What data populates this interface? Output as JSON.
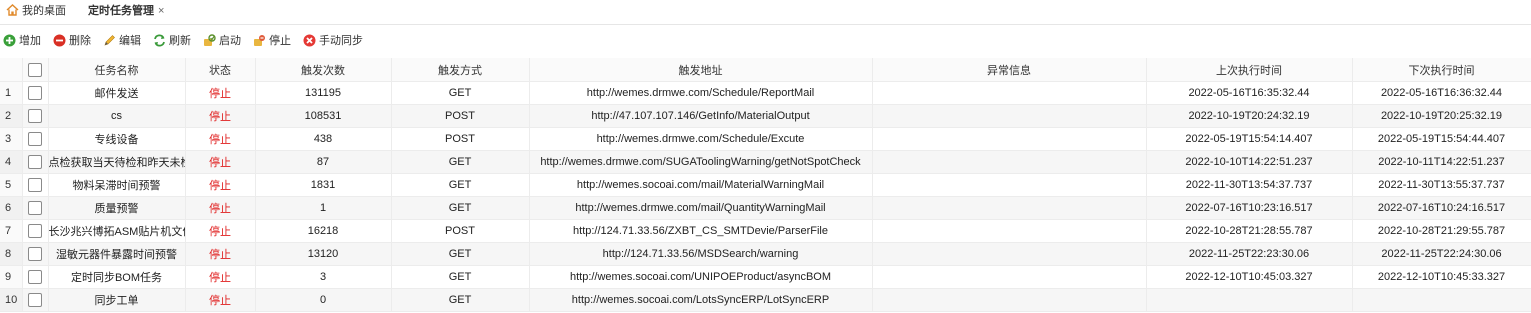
{
  "tabs": {
    "home_label": "我的桌面",
    "active_label": "定时任务管理",
    "close_glyph": "×"
  },
  "toolbar": {
    "add": "增加",
    "delete": "删除",
    "edit": "编辑",
    "refresh": "刷新",
    "start": "启动",
    "stop": "停止",
    "manual_sync": "手动同步"
  },
  "table": {
    "headers": [
      "任务名称",
      "状态",
      "触发次数",
      "触发方式",
      "触发地址",
      "异常信息",
      "上次执行时间",
      "下次执行时间"
    ],
    "rows": [
      {
        "rn": "1",
        "name": "邮件发送",
        "state": "停止",
        "count": "131195",
        "method": "GET",
        "url": "http://wemes.drmwe.com/Schedule/ReportMail",
        "error": "",
        "last": "2022-05-16T16:35:32.44",
        "next": "2022-05-16T16:36:32.44"
      },
      {
        "rn": "2",
        "name": "cs",
        "state": "停止",
        "count": "108531",
        "method": "POST",
        "url": "http://47.107.107.146/GetInfo/MaterialOutput",
        "error": "",
        "last": "2022-10-19T20:24:32.19",
        "next": "2022-10-19T20:25:32.19"
      },
      {
        "rn": "3",
        "name": "专线设备",
        "state": "停止",
        "count": "438",
        "method": "POST",
        "url": "http://wemes.drmwe.com/Schedule/Excute",
        "error": "",
        "last": "2022-05-19T15:54:14.407",
        "next": "2022-05-19T15:54:44.407"
      },
      {
        "rn": "4",
        "name": "点检获取当天待检和昨天未检",
        "state": "停止",
        "count": "87",
        "method": "GET",
        "url": "http://wemes.drmwe.com/SUGAToolingWarning/getNotSpotCheck",
        "error": "",
        "last": "2022-10-10T14:22:51.237",
        "next": "2022-10-11T14:22:51.237"
      },
      {
        "rn": "5",
        "name": "物料呆滞时间预警",
        "state": "停止",
        "count": "1831",
        "method": "GET",
        "url": "http://wemes.socoai.com/mail/MaterialWarningMail",
        "error": "",
        "last": "2022-11-30T13:54:37.737",
        "next": "2022-11-30T13:55:37.737"
      },
      {
        "rn": "6",
        "name": "质量预警",
        "state": "停止",
        "count": "1",
        "method": "GET",
        "url": "http://wemes.drmwe.com/mail/QuantityWarningMail",
        "error": "",
        "last": "2022-07-16T10:23:16.517",
        "next": "2022-07-16T10:24:16.517"
      },
      {
        "rn": "7",
        "name": "长沙兆兴博拓ASM贴片机文件",
        "state": "停止",
        "count": "16218",
        "method": "POST",
        "url": "http://124.71.33.56/ZXBT_CS_SMTDevie/ParserFile",
        "error": "",
        "last": "2022-10-28T21:28:55.787",
        "next": "2022-10-28T21:29:55.787"
      },
      {
        "rn": "8",
        "name": "湿敏元器件暴露时间预警",
        "state": "停止",
        "count": "13120",
        "method": "GET",
        "url": "http://124.71.33.56/MSDSearch/warning",
        "error": "",
        "last": "2022-11-25T22:23:30.06",
        "next": "2022-11-25T22:24:30.06"
      },
      {
        "rn": "9",
        "name": "定时同步BOM任务",
        "state": "停止",
        "count": "3",
        "method": "GET",
        "url": "http://wemes.socoai.com/UNIPOEProduct/asyncBOM",
        "error": "",
        "last": "2022-12-10T10:45:03.327",
        "next": "2022-12-10T10:45:33.327"
      },
      {
        "rn": "10",
        "name": "同步工单",
        "state": "停止",
        "count": "0",
        "method": "GET",
        "url": "http://wemes.socoai.com/LotsSyncERP/LotSyncERP",
        "error": "",
        "last": "",
        "next": ""
      }
    ]
  },
  "colors": {
    "state_stopped": "#e02020",
    "add_icon": "#3aa03a",
    "delete_icon": "#d93025",
    "manual_sync_icon": "#e53935"
  }
}
